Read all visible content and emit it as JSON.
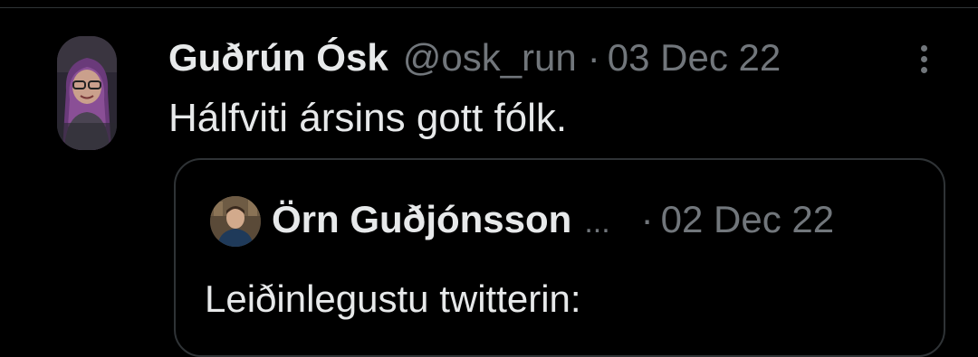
{
  "tweet": {
    "display_name": "Guðrún Ósk",
    "handle": "@osk_run",
    "separator": "·",
    "date": "03 Dec 22",
    "text": "Hálfviti ársins gott fólk."
  },
  "quoted_tweet": {
    "display_name": "Örn Guðjónsson",
    "truncation": "...",
    "separator": "·",
    "date": "02 Dec 22",
    "text": "Leiðinlegustu twitterin:"
  },
  "icons": {
    "more": "more-vertical-icon"
  },
  "colors": {
    "background": "#000000",
    "primary_text": "#e7e9ea",
    "secondary_text": "#71767b",
    "border": "#2f3336"
  }
}
